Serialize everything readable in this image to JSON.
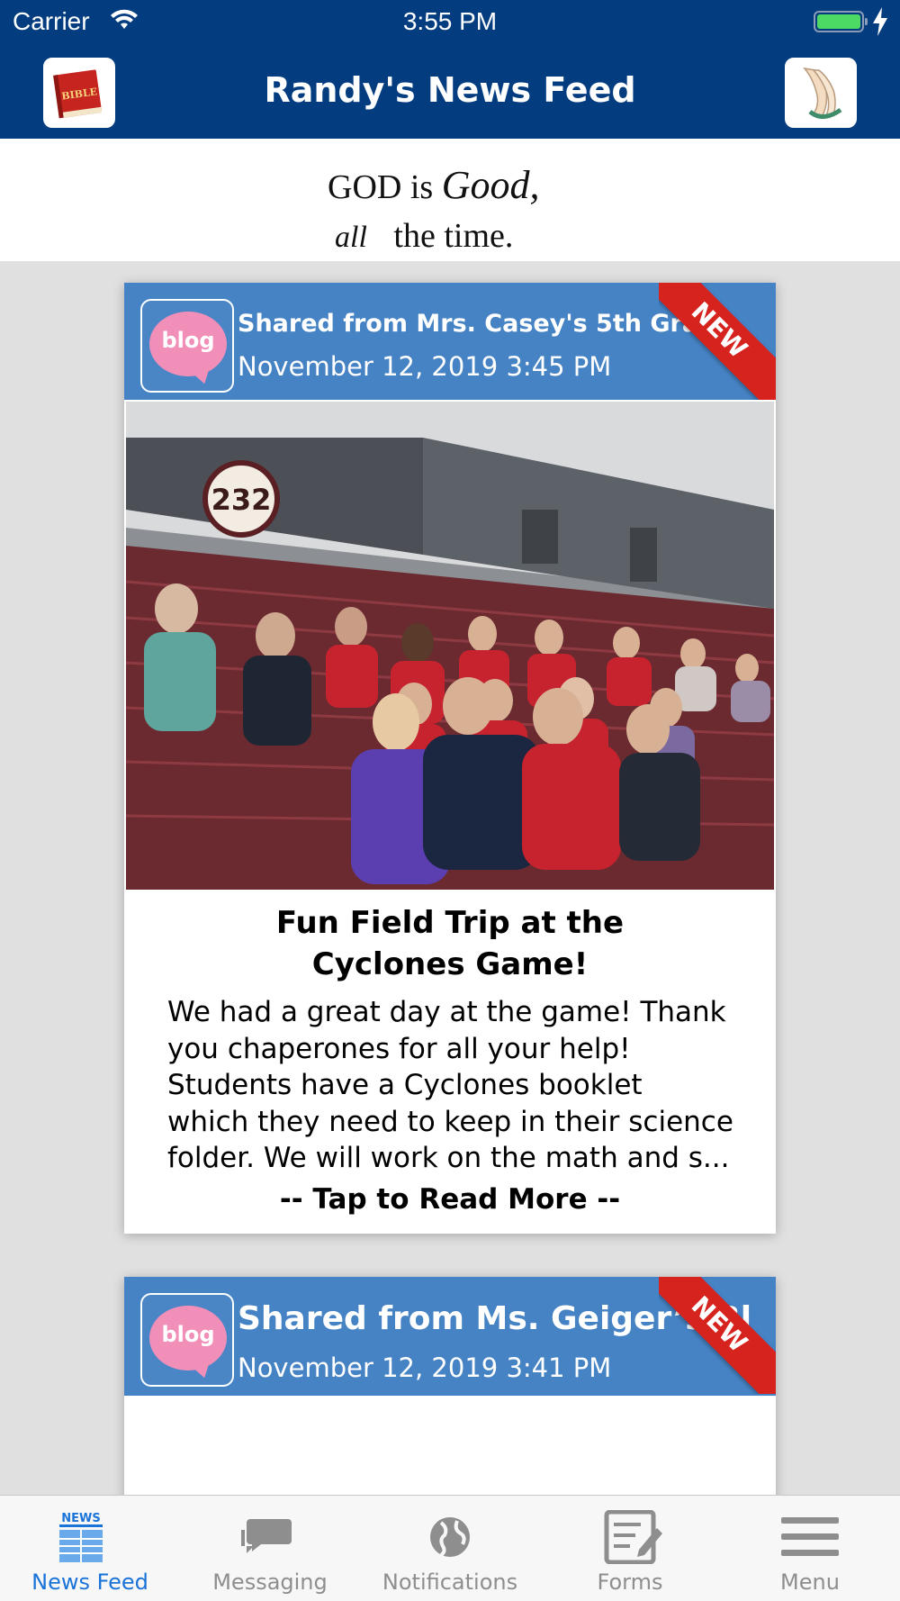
{
  "status_bar": {
    "carrier": "Carrier",
    "time": "3:55 PM",
    "battery_level": 1.0
  },
  "nav": {
    "title": "Randy's News Feed",
    "left_button_icon": "bible-icon",
    "right_button_icon": "praying-hands-icon",
    "bible_text": "BIBLE"
  },
  "banner": {
    "line1_a": "GOD is",
    "line1_b": "Good,",
    "line2_a": "all",
    "line2_b": "the time."
  },
  "posts": [
    {
      "icon_label": "blog",
      "source": "Shared from Mrs. Casey's 5th Grade",
      "date": "November 12, 2019  3:45 PM",
      "badge": "NEW",
      "photo_sign": "232",
      "title_line1": "Fun Field Trip at the",
      "title_line2": "Cyclones Game!",
      "body_lines": [
        "We had a great day at the game!  Thank",
        "you chaperones for all your help!",
        "Students have a Cyclones booklet",
        "which they need to keep in their science",
        "folder.  We will work on the math and s..."
      ],
      "read_more": "-- Tap to Read More --"
    },
    {
      "icon_label": "blog",
      "source": "Shared from Ms. Geiger’s Bl",
      "date": "November 12, 2019  3:41 PM",
      "badge": "NEW"
    }
  ],
  "tabs": [
    {
      "label": "News Feed",
      "icon": "newspaper-icon",
      "active": true,
      "icon_text": "NEWS"
    },
    {
      "label": "Messaging",
      "icon": "chat-bubbles-icon",
      "active": false
    },
    {
      "label": "Notifications",
      "icon": "globe-icon",
      "active": false
    },
    {
      "label": "Forms",
      "icon": "form-edit-icon",
      "active": false
    },
    {
      "label": "Menu",
      "icon": "hamburger-menu-icon",
      "active": false
    }
  ],
  "colors": {
    "nav_blue": "#033d80",
    "card_header_blue": "#4683c4",
    "new_ribbon_red": "#d6231e",
    "blog_pink": "#f28fb8",
    "tab_active": "#1a73d8",
    "tab_inactive": "#8e8e8e"
  }
}
